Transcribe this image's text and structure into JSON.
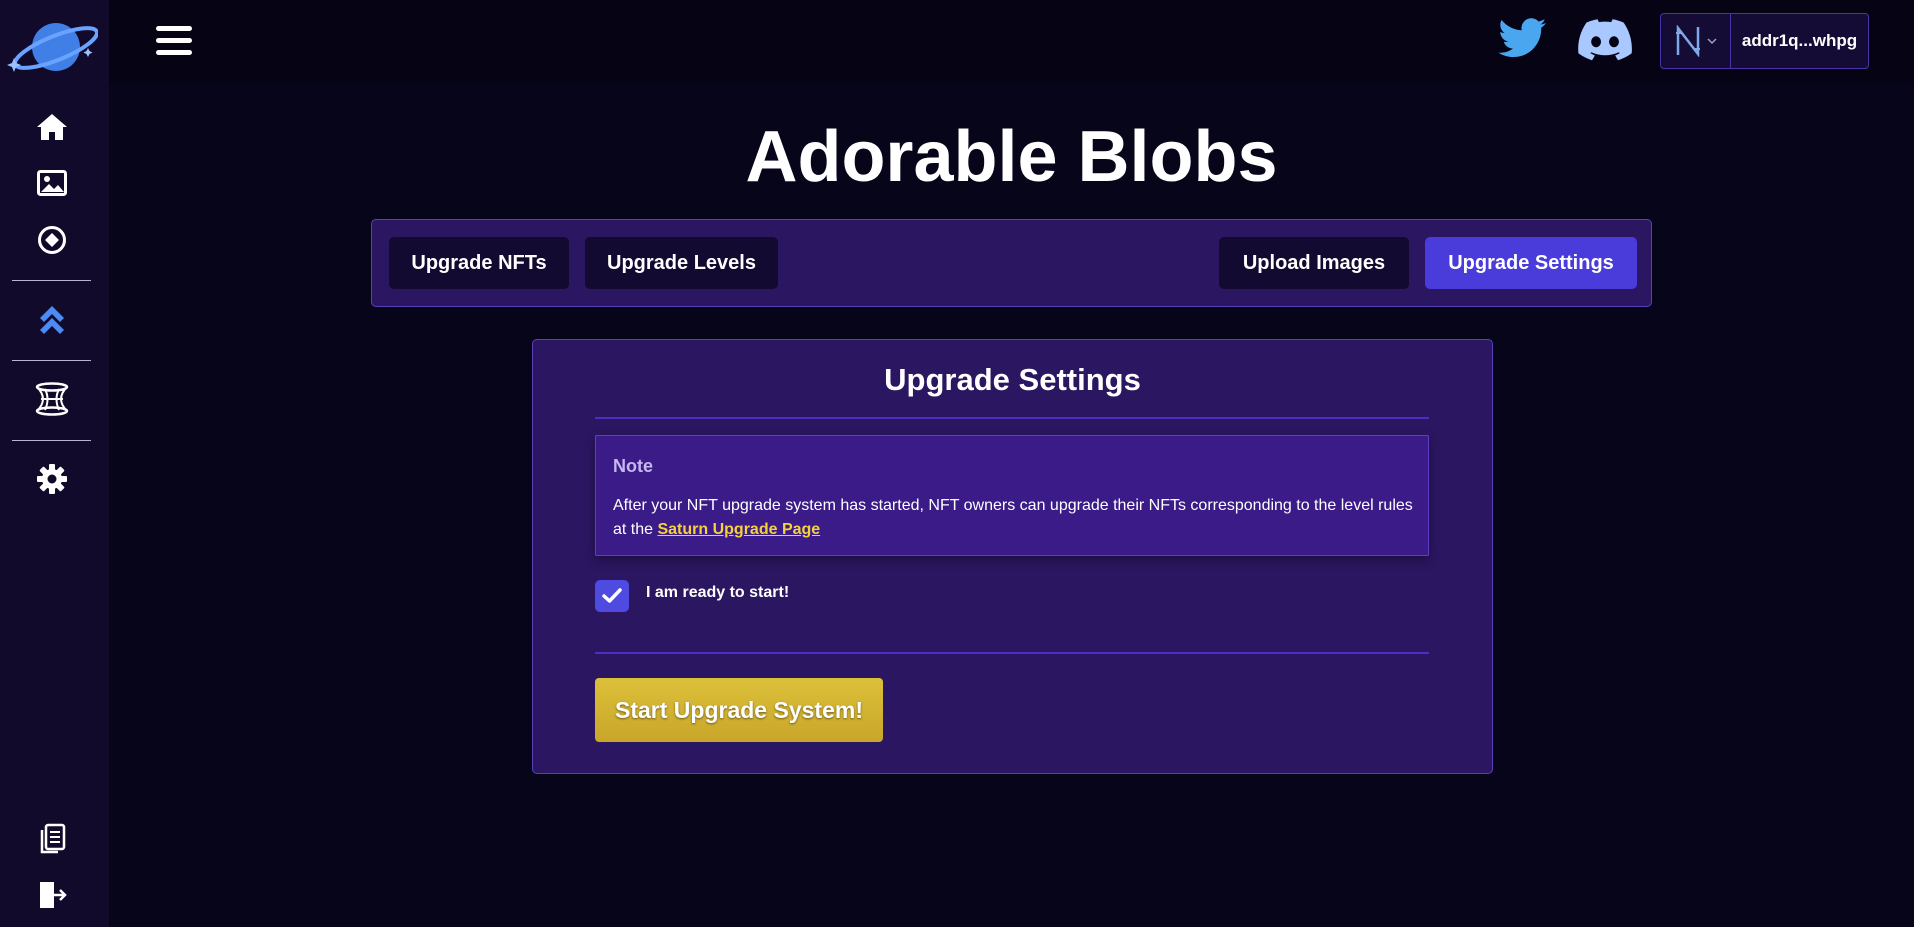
{
  "sidebar": {
    "icons": [
      "saturn-logo",
      "home-icon",
      "image-icon",
      "circle-dot-icon",
      "chevrons-up-icon",
      "warp-icon",
      "gear-icon",
      "documents-icon",
      "logout-icon"
    ]
  },
  "header": {
    "wallet_address": "addr1q...whpg",
    "wallet_network": "N"
  },
  "page": {
    "title": "Adorable Blobs"
  },
  "tabs": [
    {
      "label": "Upgrade NFTs",
      "active": false
    },
    {
      "label": "Upgrade Levels",
      "active": false
    },
    {
      "label": "Upload Images",
      "active": false
    },
    {
      "label": "Upgrade Settings",
      "active": true
    }
  ],
  "card": {
    "title": "Upgrade Settings",
    "note_title": "Note",
    "note_text": "After your NFT upgrade system has started, NFT owners can upgrade their NFTs corresponding to the level rules at the",
    "note_link": "Saturn Upgrade Page",
    "checkbox_label": "I am ready to start!",
    "checkbox_checked": true,
    "start_button": "Start Upgrade System!"
  },
  "colors": {
    "accent": "#4a3bdb",
    "panel": "#2b1661",
    "gold": "#dcc03a",
    "link": "#f5d23c"
  }
}
